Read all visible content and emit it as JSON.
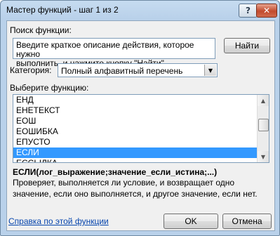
{
  "window": {
    "title": "Мастер функций - шаг 1 из 2",
    "help_button": "?",
    "close_button": "✕"
  },
  "search": {
    "label": "Поиск функции:",
    "value": "Введите краткое описание действия, которое нужно\nвыполнить, и нажмите кнопку \"Найти\"",
    "find_button": "Найти"
  },
  "category": {
    "label": "Категория:",
    "selected": "Полный алфавитный перечень"
  },
  "function_list": {
    "label": "Выберите функцию:",
    "items": [
      "ЕНД",
      "ЕНЕТЕКСТ",
      "ЕОШ",
      "ЕОШИБКА",
      "ЕПУСТО",
      "ЕСЛИ",
      "ЕССЫЛКА"
    ],
    "selected_index": 5
  },
  "details": {
    "signature": "ЕСЛИ(лог_выражение;значение_если_истина;...)",
    "description": "Проверяет, выполняется ли условие, и возвращает одно значение, если оно выполняется, и другое значение, если нет."
  },
  "footer": {
    "help_link": "Справка по этой функции",
    "ok_button": "OK",
    "cancel_button": "Отмена"
  },
  "colors": {
    "selection": "#3399ff",
    "link": "#0645ad",
    "title_bar": "#b9d1ea"
  }
}
